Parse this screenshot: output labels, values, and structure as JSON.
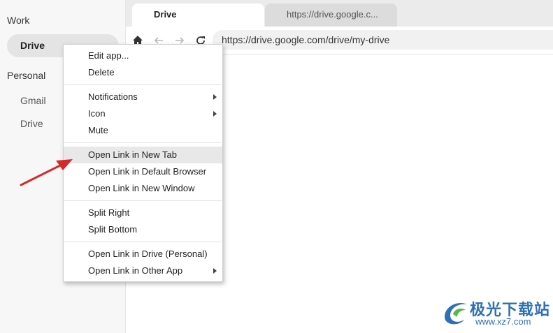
{
  "sidebar": {
    "work_label": "Work",
    "work_app": "Drive",
    "personal_label": "Personal",
    "personal_apps": [
      "Gmail",
      "Drive"
    ]
  },
  "tabs": [
    {
      "label": "Drive",
      "active": true
    },
    {
      "label": "https://drive.google.c...",
      "active": false
    }
  ],
  "toolbar": {
    "home_icon": "home-icon",
    "back_icon": "back-arrow-icon",
    "forward_icon": "forward-arrow-icon",
    "reload_icon": "reload-icon",
    "url": "https://drive.google.com/drive/my-drive"
  },
  "context_menu": {
    "items": [
      {
        "label": "Edit app..."
      },
      {
        "label": "Delete"
      },
      {
        "label": "Notifications",
        "submenu": true
      },
      {
        "label": "Icon",
        "submenu": true
      },
      {
        "label": "Mute"
      },
      {
        "label": "Open Link in New Tab",
        "highlighted": true
      },
      {
        "label": "Open Link in Default Browser"
      },
      {
        "label": "Open Link in New Window"
      },
      {
        "label": "Split Right"
      },
      {
        "label": "Split Bottom"
      },
      {
        "label": "Open Link in Drive (Personal)"
      },
      {
        "label": "Open Link in Other App",
        "submenu": true
      }
    ]
  },
  "annotation": {
    "color": "#d42a2a"
  },
  "watermark": {
    "text_cn": "极光下载站",
    "url": "www.xz7.com",
    "color": "#2e6fb5"
  }
}
